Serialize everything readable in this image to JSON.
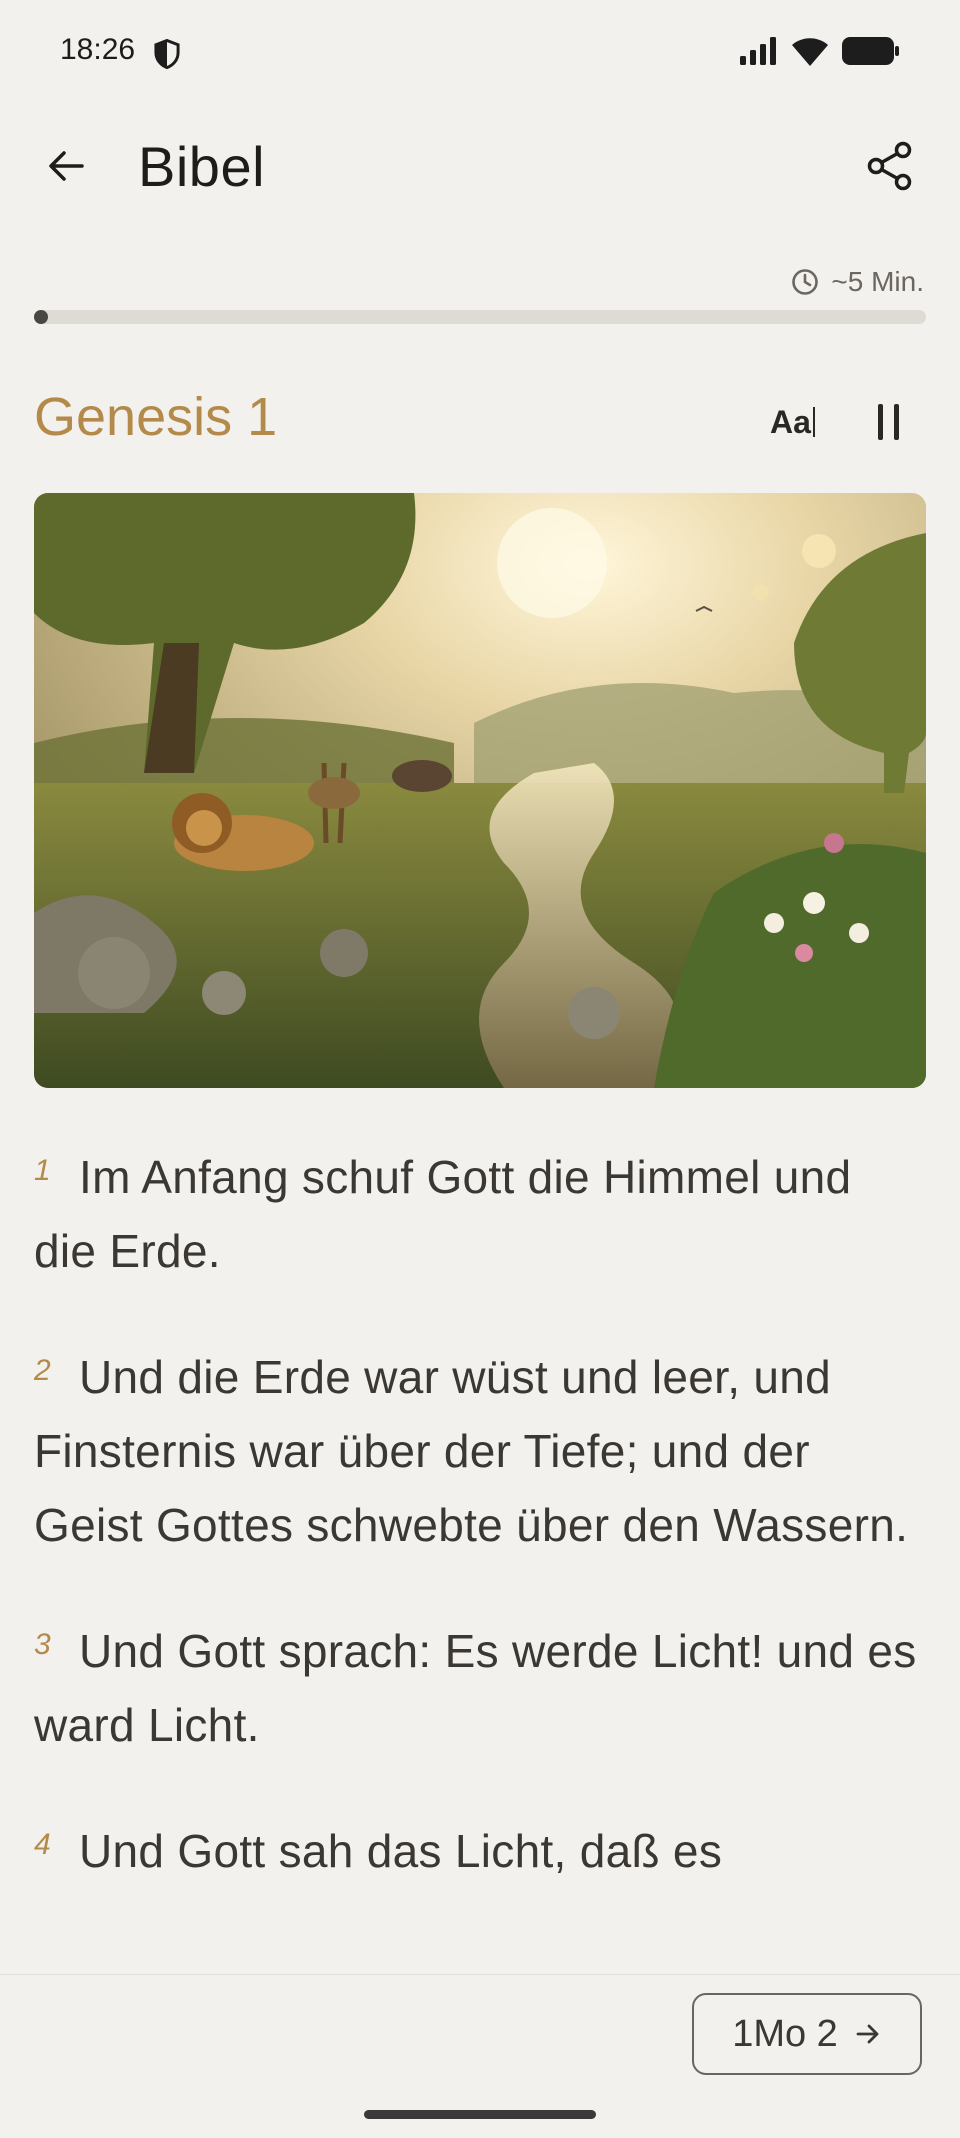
{
  "status_bar": {
    "time": "18:26"
  },
  "app_bar": {
    "title": "Bibel"
  },
  "reading": {
    "time_label": "~5 Min.",
    "progress_fraction": 0.01
  },
  "chapter": {
    "title": "Genesis 1",
    "font_size_label": "Aa",
    "verses": [
      {
        "num": "1",
        "text": "Im Anfang schuf Gott die Himmel und die Erde."
      },
      {
        "num": "2",
        "text": "Und die Erde war wüst und leer, und Finsternis war über der Tiefe; und der Geist Gottes schwebte über den Wassern."
      },
      {
        "num": "3",
        "text": "Und Gott sprach: Es werde Licht! und es ward Licht."
      },
      {
        "num": "4",
        "text": "Und Gott sah das Licht, daß es"
      }
    ]
  },
  "bottom_bar": {
    "next_label": "1Mo 2"
  },
  "colors": {
    "background": "#f3f1ed",
    "accent": "#b48a4b",
    "text": "#3b3833"
  },
  "icons": [
    "shield-icon",
    "signal-icon",
    "wifi-icon",
    "battery-icon",
    "arrow-left-icon",
    "share-icon",
    "clock-icon",
    "pause-icon",
    "arrow-right-icon"
  ]
}
